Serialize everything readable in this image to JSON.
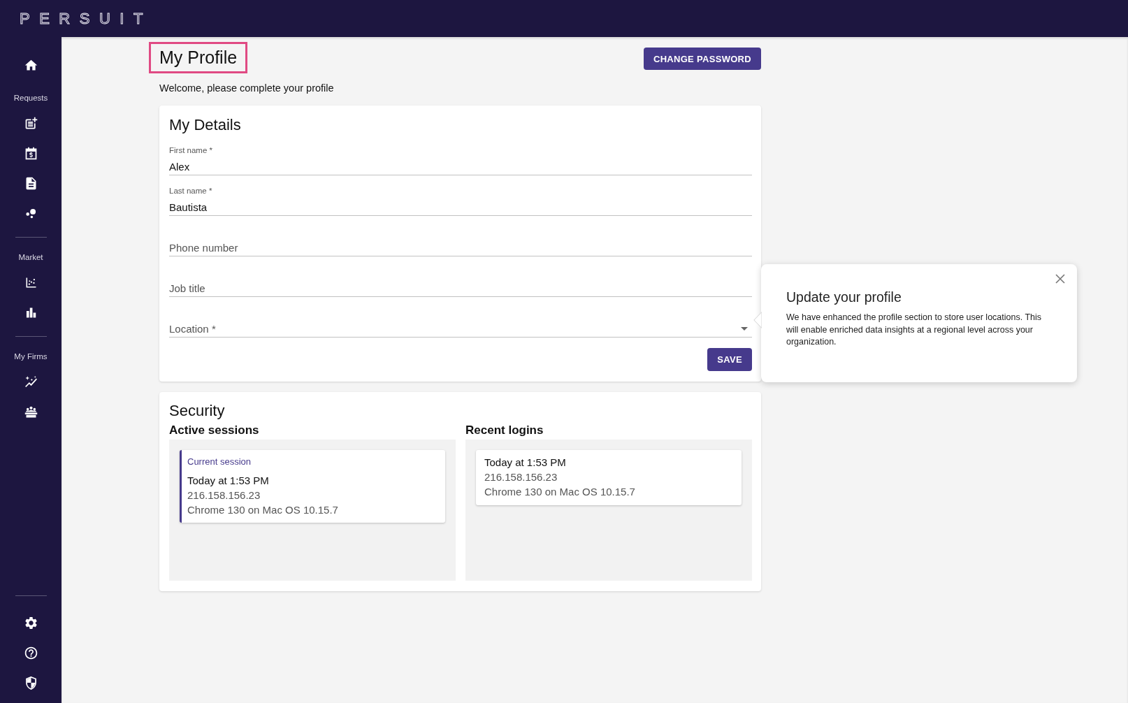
{
  "top_bar": {
    "logo": "PERSUIT"
  },
  "sidebar": {
    "section_headings": [
      "Requests",
      "Market",
      "My Firms"
    ]
  },
  "header": {
    "title": "My Profile",
    "title_highlighted": true,
    "change_password_button": "CHANGE PASSWORD",
    "welcome": "Welcome, please complete your profile"
  },
  "details": {
    "title": "My Details",
    "fields": [
      {
        "kind": "text",
        "label": "First name *",
        "value": "Alex"
      },
      {
        "kind": "text",
        "label": "Last name *",
        "value": "Bautista"
      },
      {
        "kind": "text",
        "placeholder": "Phone number"
      },
      {
        "kind": "text",
        "placeholder": "Job title"
      },
      {
        "kind": "select",
        "placeholder": "Location *"
      }
    ],
    "save_button": "SAVE"
  },
  "security": {
    "title": "Security",
    "active_sessions": {
      "heading": "Active sessions",
      "items": [
        {
          "current": true,
          "tag": "Current session",
          "time": "Today at 1:53 PM",
          "ip": "216.158.156.23",
          "device": "Chrome 130 on Mac OS 10.15.7"
        }
      ]
    },
    "recent_logins": {
      "heading": "Recent logins",
      "items": [
        {
          "current": false,
          "time": "Today at 1:53 PM",
          "ip": "216.158.156.23",
          "device": "Chrome 130 on Mac OS 10.15.7"
        }
      ]
    }
  },
  "popover": {
    "title": "Update your profile",
    "body": "We have enhanced the profile section to store user locations. This will enable enriched data insights at a regional level across your organization."
  }
}
